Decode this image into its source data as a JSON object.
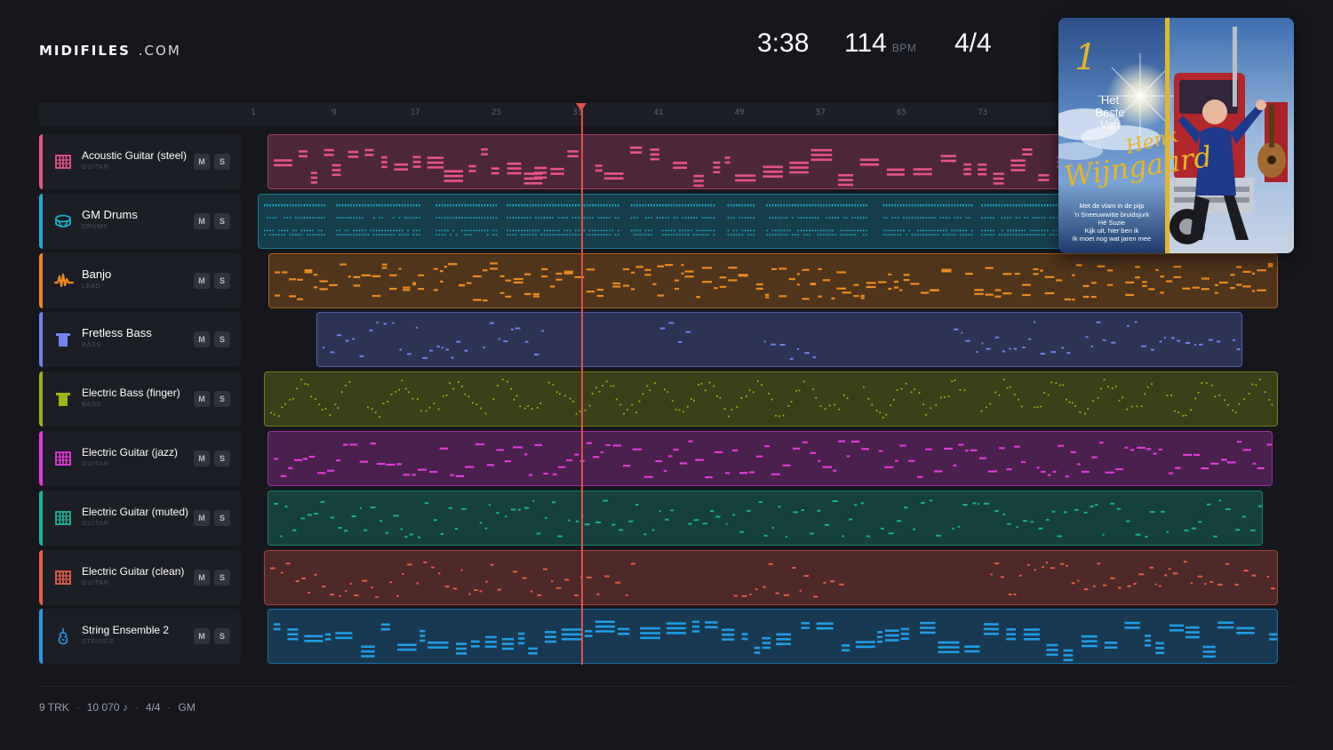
{
  "brand": {
    "name_bold": "MIDIFILES",
    "name_rest": ".COM"
  },
  "header": {
    "duration": "3:38",
    "tempo": "114",
    "tempo_unit": "BPM",
    "time_signature": "4/4"
  },
  "ruler": {
    "marks": [
      "1",
      "9",
      "17",
      "25",
      "33",
      "41",
      "49",
      "57",
      "65",
      "73"
    ]
  },
  "playhead": {
    "bar": 33
  },
  "tracks": [
    {
      "name": "Acoustic Guitar (steel)",
      "category": "GUITAR",
      "icon": "guitar-fretboard-icon",
      "color": "#e8528a",
      "mute": "M",
      "solo": "S"
    },
    {
      "name": "GM Drums",
      "category": "DRUMS",
      "icon": "drum-icon",
      "color": "#1ab0cc",
      "mute": "M",
      "solo": "S"
    },
    {
      "name": "Banjo",
      "category": "LEAD",
      "icon": "waveform-icon",
      "color": "#ee8a1c",
      "mute": "M",
      "solo": "S"
    },
    {
      "name": "Fretless Bass",
      "category": "BASS",
      "icon": "bass-icon",
      "color": "#7183ee",
      "mute": "M",
      "solo": "S"
    },
    {
      "name": "Electric Bass (finger)",
      "category": "BASS",
      "icon": "bass-icon",
      "color": "#9cb512",
      "mute": "M",
      "solo": "S"
    },
    {
      "name": "Electric Guitar (jazz)",
      "category": "GUITAR",
      "icon": "guitar-fretboard-icon",
      "color": "#e23ad8",
      "mute": "M",
      "solo": "S"
    },
    {
      "name": "Electric Guitar (muted)",
      "category": "GUITAR",
      "icon": "guitar-fretboard-icon",
      "color": "#16b496",
      "mute": "M",
      "solo": "S"
    },
    {
      "name": "Electric Guitar (clean)",
      "category": "GUITAR",
      "icon": "guitar-fretboard-icon",
      "color": "#ea5d46",
      "mute": "M",
      "solo": "S"
    },
    {
      "name": "String Ensemble 2",
      "category": "STRINGS",
      "icon": "violin-icon",
      "color": "#1f9ce6",
      "mute": "M",
      "solo": "S"
    }
  ],
  "album": {
    "number": "1",
    "line1": "Het",
    "line2": "Beste",
    "line3": "Van",
    "artist_first": "Henk",
    "artist_last": "Wijngaard",
    "songs": [
      "Met de vlam in de pijp",
      "'n Sneeuwwitte bruidsjurk",
      "Hé Suzie",
      "Kijk uit, hier ben ik",
      "Ik moet nog wat jaren mee"
    ]
  },
  "footer": {
    "tracks": "9 TRK",
    "notes": "10 070 ♪",
    "time_signature": "4/4",
    "standard": "GM"
  }
}
